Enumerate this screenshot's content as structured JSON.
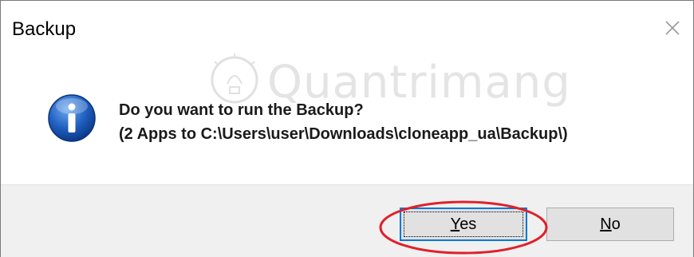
{
  "window": {
    "title": "Backup",
    "close_label": "×"
  },
  "watermark": {
    "text": "Quantrimang"
  },
  "message": {
    "line1": "Do you want to run the Backup?",
    "line2": "(2 Apps to C:\\Users\\user\\Downloads\\cloneapp_ua\\Backup\\)"
  },
  "buttons": {
    "yes": {
      "mnemonic": "Y",
      "rest": "es"
    },
    "no": {
      "mnemonic": "N",
      "rest": "o"
    }
  },
  "colors": {
    "accent": "#0078d7",
    "highlight": "#e0202a",
    "info_icon": "#1f5fbf"
  },
  "icons": {
    "info": "info-icon",
    "close": "close-icon",
    "watermark": "lightbulb-icon"
  }
}
